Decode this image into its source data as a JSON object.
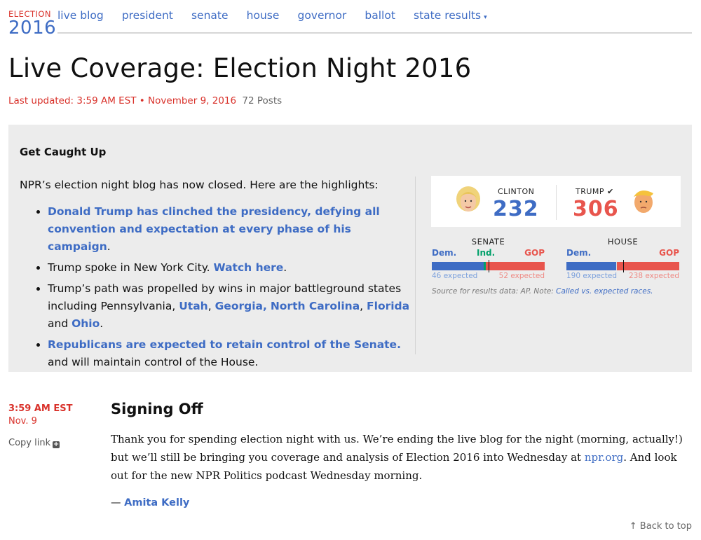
{
  "brand": {
    "line1": "ELECTION",
    "line2": "2016"
  },
  "nav": {
    "live_blog": "live blog",
    "president": "president",
    "senate": "senate",
    "house": "house",
    "governor": "governor",
    "ballot": "ballot",
    "state_results": "state results",
    "caret": "▾"
  },
  "page": {
    "title": "Live Coverage: Election Night 2016",
    "updated": "Last updated: 3:59 AM EST • November 9, 2016",
    "posts": "72 Posts"
  },
  "summary": {
    "heading": "Get Caught Up",
    "intro": "NPR’s election night blog has now closed. Here are the highlights:",
    "b1_link": "Donald Trump has clinched the presidency, defying all convention and expectation at every phase of his campaign",
    "b1_end": ".",
    "b2_text": "Trump spoke in New York City. ",
    "b2_link": "Watch here",
    "b2_end": ".",
    "b3_text": "Trump’s path was propelled by wins in major battleground states including Pennsylvania, ",
    "b3_utah": "Utah",
    "b3_georgia": "Georgia,",
    "b3_nc": "North Carolina",
    "b3_comma": ",",
    "b3_florida": "Florida",
    "b3_and": " and ",
    "b3_ohio": "Ohio",
    "b3_end": ".",
    "b4_link": "Republicans are expected to retain control of the Senate.",
    "b4_text": "and will maintain control of the House."
  },
  "results": {
    "clinton": {
      "label": "CLINTON",
      "votes": "232"
    },
    "trump": {
      "label": "TRUMP",
      "check": "✔",
      "votes": "306"
    },
    "senate": {
      "title": "SENATE",
      "dem": "Dem.",
      "ind": "Ind.",
      "gop": "GOP",
      "dem_expected": "46 expected",
      "gop_expected": "52 expected",
      "dem_share": 0.46,
      "ind_share": 0.02,
      "gop_share": 0.52
    },
    "house": {
      "title": "HOUSE",
      "dem": "Dem.",
      "gop": "GOP",
      "dem_expected": "190 expected",
      "gop_expected": "238 expected",
      "dem_share": 0.44,
      "gop_share": 0.55
    },
    "source_text": "Source for results data: AP. Note: ",
    "source_link": "Called vs. expected races."
  },
  "colors": {
    "dem": "#3e6cc4",
    "gop": "#e8554d",
    "ind": "#00a06a",
    "accent_red": "#d9322b"
  },
  "post": {
    "time": "3:59 AM EST",
    "date": "Nov. 9",
    "copy_link": "Copy link",
    "title": "Signing Off",
    "body_a": "Thank you for spending election night with us. We’re ending the live blog for the night (morning, actually!) but we’ll still be bringing you coverage and analysis of Election 2016 into Wednesday at ",
    "body_link": "npr.org",
    "body_b": ". And look out for the new NPR Politics podcast Wednesday morning.",
    "author_dash": "— ",
    "author": "Amita Kelly"
  },
  "footer": {
    "back_to_top": "↑ Back to top"
  }
}
